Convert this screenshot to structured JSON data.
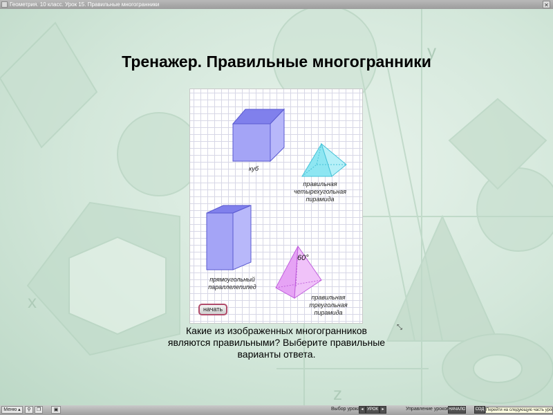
{
  "window": {
    "title": "Геометрия. 10 класс. Урок 15. Правильные многогранники",
    "close_label": "✕"
  },
  "main": {
    "heading": "Тренажер. Правильные многогранники",
    "shapes": {
      "cube": "куб",
      "quad_pyramid": [
        "правильная",
        "четырехугольная",
        "пирамида"
      ],
      "box": [
        "прямоугольный",
        "параллелепипед"
      ],
      "tri_pyramid": [
        "правильная",
        "треугольная",
        "пирамида"
      ],
      "angle": "60°"
    },
    "start_button": "начать",
    "question": [
      "Какие из изображенных многогранников",
      "являются  правильными? Выберите правильные",
      "варианты ответа."
    ],
    "expand_icon": "expand-icon"
  },
  "bottombar": {
    "menu_label": "Меню ▴",
    "lesson_select_label": "Выбор урока:",
    "lesson_button": "УРОК",
    "control_label": "Управление уроком:",
    "start_button": "НАЧАЛО",
    "content_button": "СОД",
    "tooltip": "Перейти на следующую часть урока"
  },
  "colors": {
    "cube": "#8c8cf0",
    "pyramid_cyan": "#7fe0ee",
    "pyramid_violet": "#e08ef2",
    "accent_button_border": "#b04a6a"
  }
}
